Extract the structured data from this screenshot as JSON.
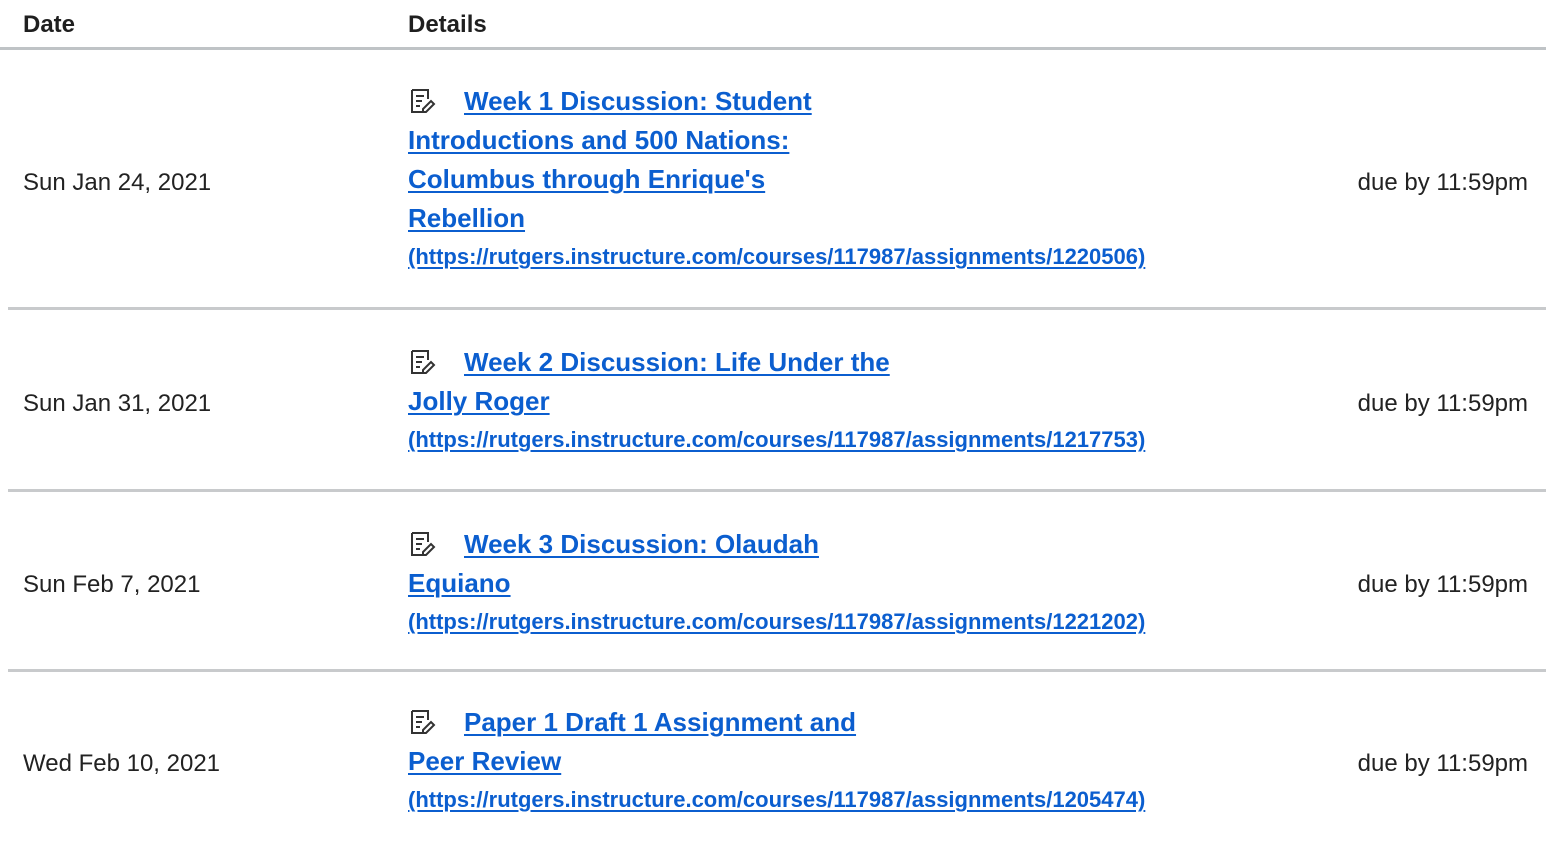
{
  "table": {
    "header": {
      "date": "Date",
      "details": "Details"
    },
    "rows": [
      {
        "date": "Sun Jan 24, 2021",
        "title_lines": [
          "Week 1 Discussion: Student",
          "Introductions and 500 Nations:",
          "Columbus through Enrique's",
          "Rebellion"
        ],
        "url": "(https://rutgers.instructure.com/courses/117987/assignments/1220506)",
        "due": "due by 11:59pm",
        "icon": "assignment-icon"
      },
      {
        "date": "Sun Jan 31, 2021",
        "title_lines": [
          "Week 2 Discussion: Life Under the",
          "Jolly Roger"
        ],
        "url": "(https://rutgers.instructure.com/courses/117987/assignments/1217753)",
        "due": "due by 11:59pm",
        "icon": "assignment-icon"
      },
      {
        "date": "Sun Feb 7, 2021",
        "title_lines": [
          "Week 3 Discussion: Olaudah",
          "Equiano"
        ],
        "url": "(https://rutgers.instructure.com/courses/117987/assignments/1221202)",
        "due": "due by 11:59pm",
        "icon": "assignment-icon"
      },
      {
        "date": "Wed Feb 10, 2021",
        "title_lines": [
          "Paper 1 Draft 1 Assignment and",
          "Peer Review"
        ],
        "url": "(https://rutgers.instructure.com/courses/117987/assignments/1205474)",
        "due": "due by 11:59pm",
        "icon": "assignment-icon"
      }
    ]
  },
  "colors": {
    "link": "#0b5ecf",
    "divider": "#c8cacc",
    "text": "#222222"
  }
}
